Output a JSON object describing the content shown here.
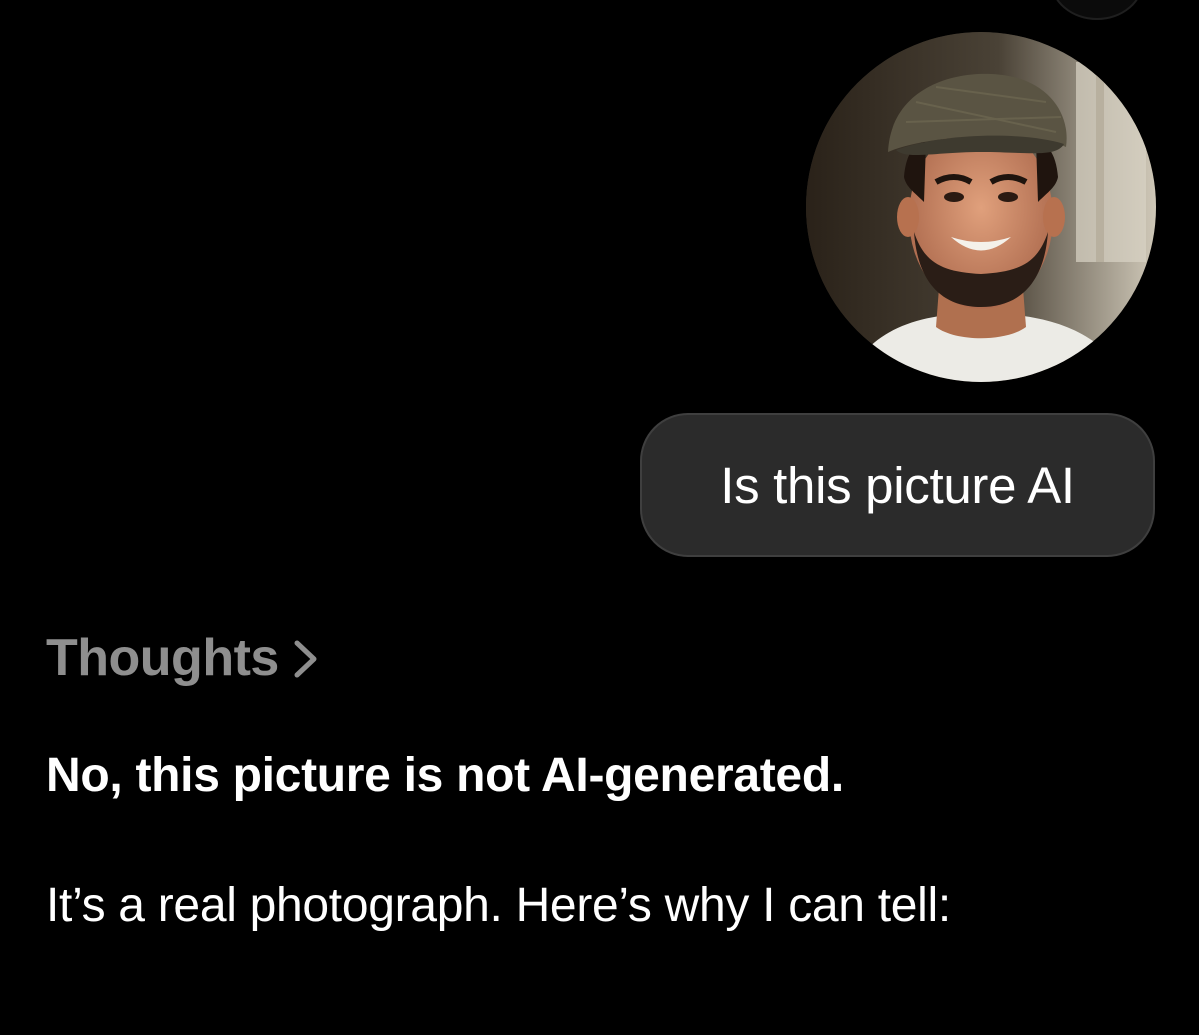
{
  "conversation": {
    "user_message": {
      "attachment": {
        "kind": "photo",
        "icon": "man-portrait-photo"
      },
      "text": "Is this picture AI"
    },
    "assistant_message": {
      "thoughts_label": "Thoughts",
      "thoughts_icon": "chevron-right-icon",
      "heading": "No, this picture is not AI-generated.",
      "body": "It’s a real photograph. Here’s why I can tell:"
    }
  },
  "colors": {
    "background": "#000000",
    "user_bubble": "#2b2b2b",
    "muted_text": "#8e8e8e",
    "text": "#ffffff"
  }
}
